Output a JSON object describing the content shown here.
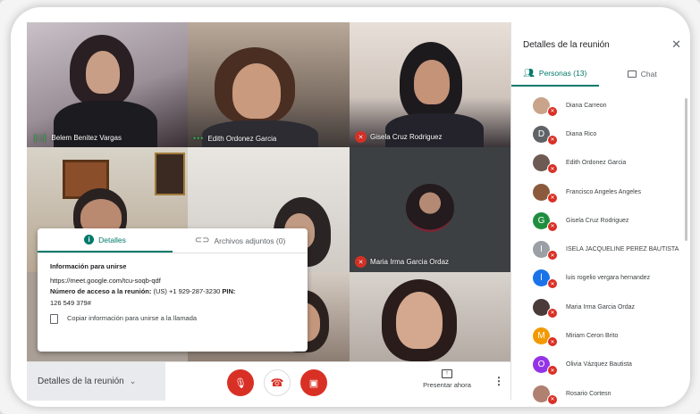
{
  "tiles": [
    {
      "name": "Belem Benitez Vargas",
      "status": "speaking"
    },
    {
      "name": "Edith Ordonez Garcia",
      "status": "dots"
    },
    {
      "name": "Gisela Cruz Rodriguez",
      "status": "muted"
    },
    {
      "name": "",
      "status": ""
    },
    {
      "name": "",
      "status": ""
    },
    {
      "name": "Maria Irma Garcia Ordaz",
      "status": "muted"
    },
    {
      "name": "",
      "status": ""
    },
    {
      "name": "",
      "status": ""
    },
    {
      "name": "",
      "status": ""
    }
  ],
  "popup": {
    "tab_details": "Detalles",
    "tab_attachments": "Archivos adjuntos (0)",
    "join_info_title": "Información para unirse",
    "meet_link": "https://meet.google.com/tcu-soqb-qdf",
    "access_label": "Número de acceso a la reunión:",
    "access_number": " (US) +1 929-287-3230 ",
    "pin_label": "PIN:",
    "pin_value": "126 549 379#",
    "copy_label": "Copiar información para unirse a la llamada"
  },
  "bottombar": {
    "meeting_details": "Detalles de la reunión",
    "present_label": "Presentar ahora"
  },
  "panel": {
    "title": "Detalles de la reunión",
    "tab_people": "Personas (13)",
    "tab_chat": "Chat",
    "people": [
      {
        "name": "Diana Carreon",
        "initial": "",
        "color": "#c9a38a"
      },
      {
        "name": "Diana Rico",
        "initial": "D",
        "color": "#5f6368"
      },
      {
        "name": "Edith Ordonez Garcia",
        "initial": "",
        "color": "#6d5a52"
      },
      {
        "name": "Francisco Angeles Angeles",
        "initial": "",
        "color": "#8b5a3c"
      },
      {
        "name": "Gisela Cruz Rodriguez",
        "initial": "G",
        "color": "#1e8e3e"
      },
      {
        "name": "ISELA JACQUELINE PEREZ BAUTISTA",
        "initial": "I",
        "color": "#9aa0a6"
      },
      {
        "name": "luis rogelio vergara hernandez",
        "initial": "l",
        "color": "#1a73e8"
      },
      {
        "name": "Maria Irma Garcia Ordaz",
        "initial": "",
        "color": "#4a3a3a"
      },
      {
        "name": "Miriam Ceron Brito",
        "initial": "M",
        "color": "#f29900"
      },
      {
        "name": "Olivia Vázquez Bautista",
        "initial": "O",
        "color": "#9334e6"
      },
      {
        "name": "Rosario Cortesn",
        "initial": "",
        "color": "#b08070"
      }
    ]
  }
}
